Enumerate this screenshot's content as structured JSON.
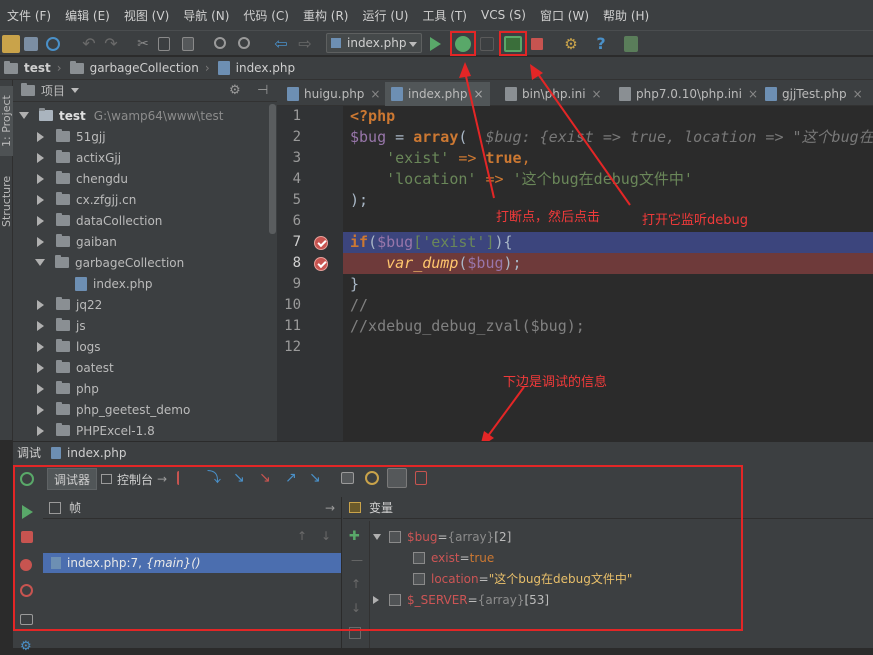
{
  "menu": [
    "文件 (F)",
    "编辑 (E)",
    "视图 (V)",
    "导航 (N)",
    "代码 (C)",
    "重构 (R)",
    "运行 (U)",
    "工具 (T)",
    "VCS (S)",
    "窗口 (W)",
    "帮助 (H)"
  ],
  "toolbar": {
    "run_config": "index.php"
  },
  "breadcrumb": [
    "test",
    "garbageCollection",
    "index.php"
  ],
  "sidestripe": {
    "project": "1: Project",
    "structure": "Structure"
  },
  "project": {
    "header": "项目",
    "root": {
      "name": "test",
      "path": "G:\\wamp64\\www\\test"
    },
    "items": [
      {
        "label": "51gjj",
        "type": "folder",
        "expanded": false
      },
      {
        "label": "actixGjj",
        "type": "folder",
        "expanded": false
      },
      {
        "label": "chengdu",
        "type": "folder",
        "expanded": false
      },
      {
        "label": "cx.zfgjj.cn",
        "type": "folder",
        "expanded": false
      },
      {
        "label": "dataCollection",
        "type": "folder",
        "expanded": false
      },
      {
        "label": "gaiban",
        "type": "folder",
        "expanded": false
      },
      {
        "label": "garbageCollection",
        "type": "folder",
        "expanded": true
      },
      {
        "label": "index.php",
        "type": "file",
        "expanded": false
      },
      {
        "label": "jq22",
        "type": "folder",
        "expanded": false
      },
      {
        "label": "js",
        "type": "folder",
        "expanded": false
      },
      {
        "label": "logs",
        "type": "folder",
        "expanded": false
      },
      {
        "label": "oatest",
        "type": "folder",
        "expanded": false
      },
      {
        "label": "php",
        "type": "folder",
        "expanded": false
      },
      {
        "label": "php_geetest_demo",
        "type": "folder",
        "expanded": false
      },
      {
        "label": "PHPExcel-1.8",
        "type": "folder",
        "expanded": false
      }
    ]
  },
  "editor_tabs": [
    {
      "label": "huigu.php",
      "active": false
    },
    {
      "label": "index.php",
      "active": true
    },
    {
      "label": "bin\\php.ini",
      "active": false
    },
    {
      "label": "php7.0.10\\php.ini",
      "active": false
    },
    {
      "label": "gjjTest.php",
      "active": false
    }
  ],
  "code": {
    "line_numbers": [
      "1",
      "2",
      "3",
      "4",
      "5",
      "6",
      "7",
      "8",
      "9",
      "10",
      "11",
      "12"
    ],
    "l1": "<?php",
    "l2_var": "$bug",
    "l2_eq": " = ",
    "l2_kw": "array",
    "l2_paren": "(",
    "l2_hint": "  $bug: {exist => true, location => \"这个bug在debug文件中\"}",
    "l3_key": "'exist'",
    "l3_arrow": " => ",
    "l3_val": "true",
    "l3_comma": ",",
    "l4_key": "'location'",
    "l4_arrow": " => ",
    "l4_val": "'这个bug在debug文件中'",
    "l5": ");",
    "l7_kw": "if",
    "l7_open": "(",
    "l7_var": "$bug",
    "l7_idx": "['exist']",
    "l7_close": "){",
    "l8_fn": "var_dump",
    "l8_open": "(",
    "l8_var": "$bug",
    "l8_close": ");",
    "l9": "}",
    "l10": "//",
    "l11": "//xdebug_debug_zval($bug);"
  },
  "breakpoint_lines": [
    7,
    8
  ],
  "annotations": {
    "set_breakpoint": "打断点，然后点击",
    "open_listen": "打开它监听debug",
    "debug_info": "下边是调试的信息"
  },
  "debug": {
    "title_label": "调试",
    "title_file": "index.php",
    "tabs": [
      "调试器",
      "控制台"
    ],
    "frames_header": "帧",
    "vars_header": "变量",
    "frame": {
      "file": "index.php:7,",
      "fn": "{main}()"
    },
    "vars": {
      "bug": {
        "name": "$bug",
        "eq": " = ",
        "type": "{array}",
        "count": " [2]"
      },
      "exist": {
        "name": "exist",
        "eq": " = ",
        "value": "true"
      },
      "location": {
        "name": "location",
        "eq": " = ",
        "value": "\"这个bug在debug文件中\""
      },
      "server": {
        "name": "$_SERVER",
        "eq": " = ",
        "type": "{array}",
        "count": " [53]"
      }
    }
  },
  "colors": {
    "accent_red": "#e32626",
    "exec_line": "#3c457d",
    "breakpoint_line": "#6e3a3a"
  }
}
